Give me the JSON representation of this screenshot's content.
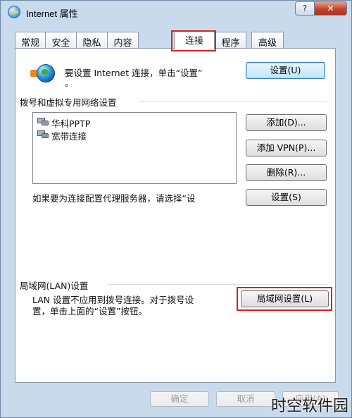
{
  "window": {
    "title": "Internet 属性",
    "help_label": "?",
    "close_label": "✕"
  },
  "tabs": [
    {
      "label": "常规"
    },
    {
      "label": "安全"
    },
    {
      "label": "隐私"
    },
    {
      "label": "内容"
    },
    {
      "label": "连接"
    },
    {
      "label": "程序"
    },
    {
      "label": "高级"
    }
  ],
  "active_tab": "连接",
  "setup": {
    "text_line1": "要设置 Internet 连接，单击“设置”",
    "text_line2": "。",
    "button": "设置(U)"
  },
  "dialup": {
    "heading": "拨号和虚拟专用网络设置",
    "connections": [
      "华科PPTP",
      "宽带连接"
    ],
    "add_button": "添加(D)...",
    "add_vpn_button": "添加 VPN(P)...",
    "remove_button": "删除(R)...",
    "proxy_text": "如果要为连接配置代理服务器，请选择“设",
    "settings_button": "设置(S)"
  },
  "lan": {
    "heading": "局域网(LAN)设置",
    "text_line1": "LAN 设置不应用到拨号连接。对于拨号设",
    "text_line2": "置，单击上面的“设置”按钮。",
    "button": "局域网设置(L)"
  },
  "footer": {
    "ok": "确定",
    "cancel": "取消",
    "apply": "应用(A)"
  },
  "watermark": "时空软件园",
  "colors": {
    "highlight_red": "#e0201a",
    "frame_blue": "#c9daed"
  }
}
